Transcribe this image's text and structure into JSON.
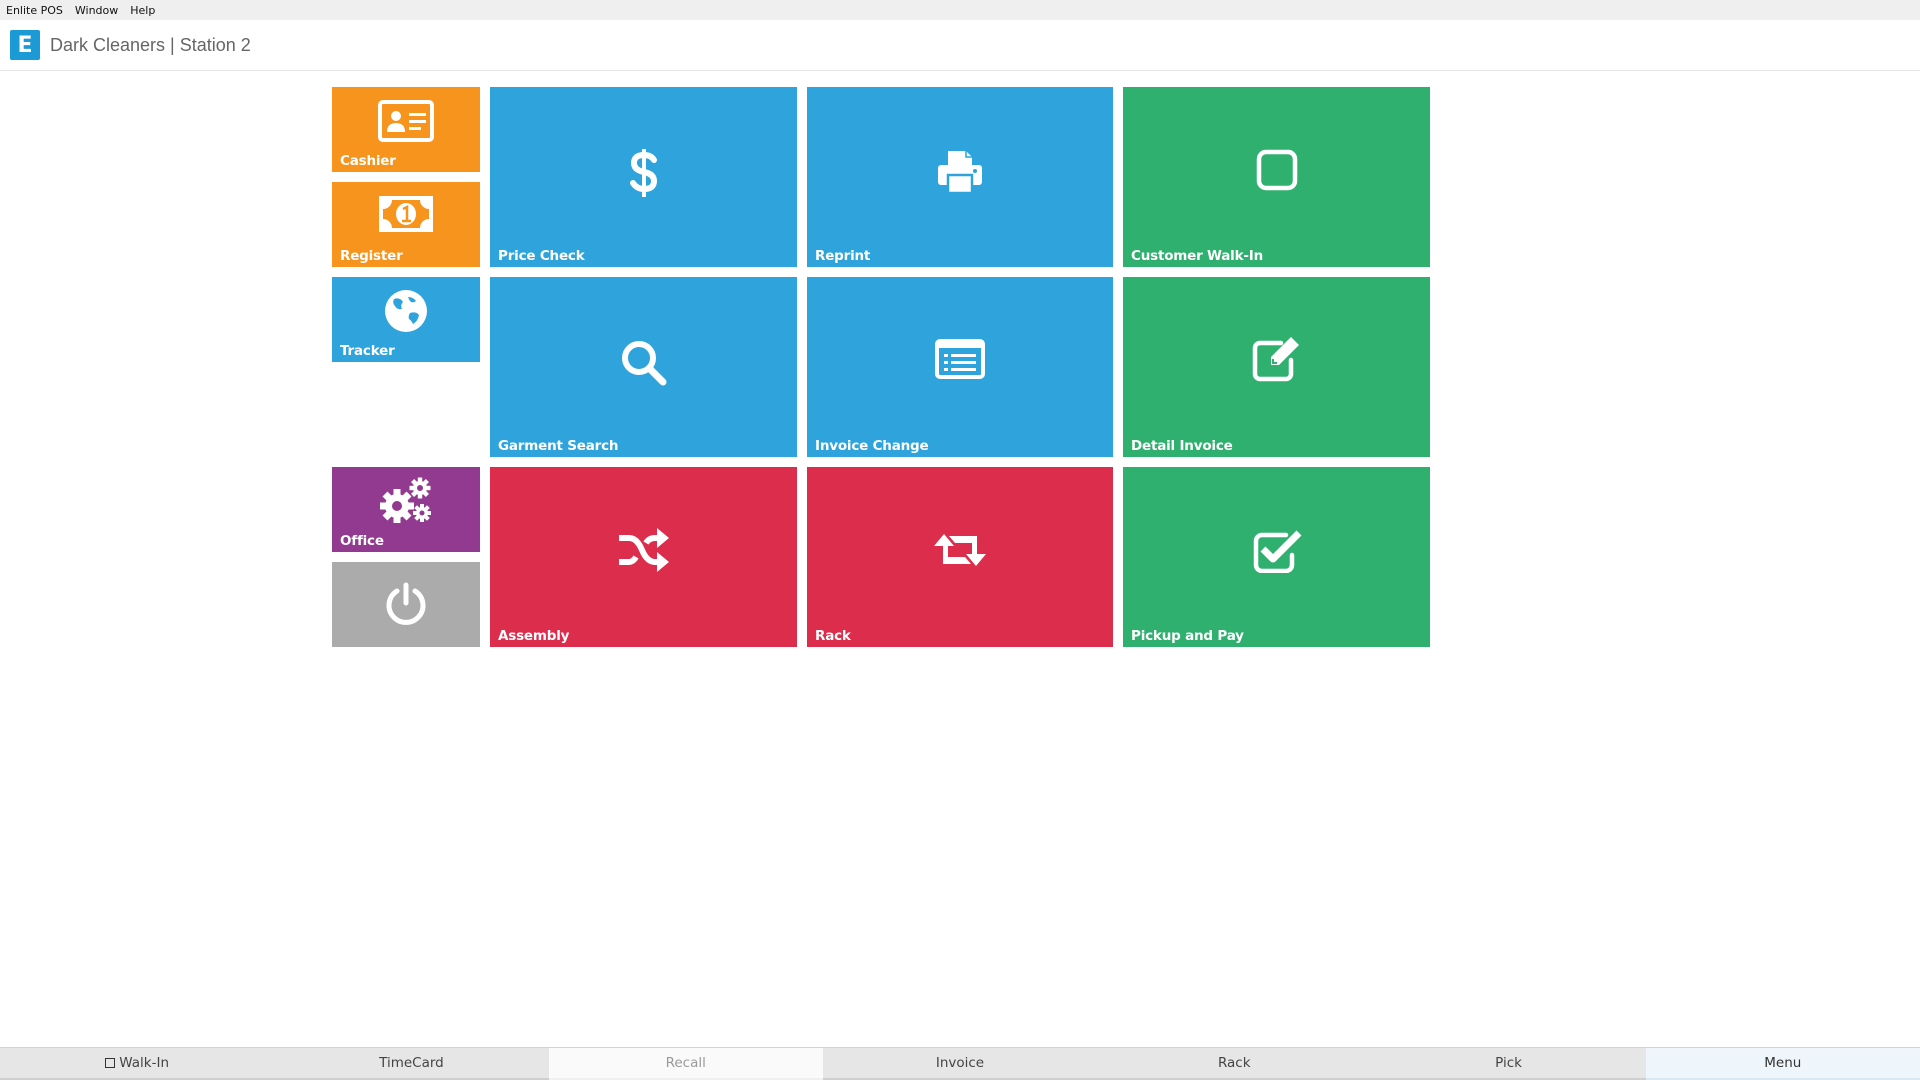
{
  "menubar": {
    "items": [
      "Enlite POS",
      "Window",
      "Help"
    ]
  },
  "header": {
    "logo_letter": "E",
    "title": "Dark Cleaners | Station 2"
  },
  "colors": {
    "orange": "#f7941d",
    "blue": "#2ea3dc",
    "green": "#30b06f",
    "red": "#dc2d4c",
    "purple": "#913a8f",
    "gray": "#ababab",
    "logo": "#1b9ad6"
  },
  "tiles": {
    "cashier": {
      "label": "Cashier",
      "icon": "id-card-icon"
    },
    "register": {
      "label": "Register",
      "icon": "money-bill-icon"
    },
    "tracker": {
      "label": "Tracker",
      "icon": "globe-icon"
    },
    "office": {
      "label": "Office",
      "icon": "gears-icon"
    },
    "power": {
      "label": "",
      "icon": "power-icon"
    },
    "price_check": {
      "label": "Price Check",
      "icon": "dollar-icon"
    },
    "reprint": {
      "label": "Reprint",
      "icon": "printer-icon"
    },
    "customer_walk_in": {
      "label": "Customer Walk-In",
      "icon": "square-icon"
    },
    "garment_search": {
      "label": "Garment Search",
      "icon": "search-icon"
    },
    "invoice_change": {
      "label": "Invoice Change",
      "icon": "list-alt-icon"
    },
    "detail_invoice": {
      "label": "Detail Invoice",
      "icon": "edit-icon"
    },
    "assembly": {
      "label": "Assembly",
      "icon": "shuffle-icon"
    },
    "rack": {
      "label": "Rack",
      "icon": "retweet-icon"
    },
    "pickup_and_pay": {
      "label": "Pickup and Pay",
      "icon": "check-square-icon"
    }
  },
  "bottom_tabs": [
    "Walk-In",
    "TimeCard",
    "Recall",
    "Invoice",
    "Rack",
    "Pick",
    "Menu"
  ]
}
